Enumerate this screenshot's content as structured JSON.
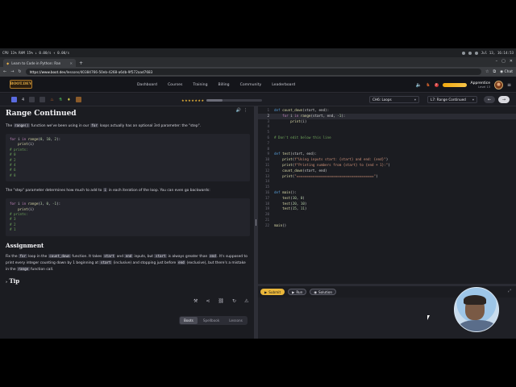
{
  "os": {
    "stats": "CPU 11% RAM 15% ↓ 0.00/s ↑ 0.00/s",
    "clock": "Jul 13, 16:14:53"
  },
  "browser": {
    "tab_title": "Learn to Code in Python: Ran",
    "url_host": "https://www.boot.dev",
    "url_path": "/lessons/40384766-50eb-4268-a6db-9f572aad7683",
    "chat_label": "Chat"
  },
  "site": {
    "logo_text": "BOOT.DEV",
    "nav": [
      "Dashboard",
      "Courses",
      "Training",
      "Billing",
      "Community",
      "Leaderboard"
    ],
    "rank_title": "Apprentice",
    "rank_level": "Level 13",
    "notif_count": "2"
  },
  "subbar": {
    "gems": "4",
    "stars": "★★★★★★★",
    "progress_fraction": 0.3,
    "chapter_select": "CH6: Loops",
    "lesson_select": "L7: Range Continued"
  },
  "lesson": {
    "title": "Range Continued",
    "p1_a": "The ",
    "p1_code1": "range()",
    "p1_b": " function we've been using in our ",
    "p1_code2": "for",
    "p1_c": " loops actually has an optional 3rd parameter: the \"step\".",
    "p2_a": "The \"step\" parameter determines how much to add to ",
    "p2_code": "i",
    "p2_b": " in each iteration of the loop. You can even go backwards:",
    "assignment_heading": "Assignment",
    "a_1": "Fix the ",
    "a_c1": "for",
    "a_2": " loop in the ",
    "a_c2": "count_down",
    "a_3": " function. It takes ",
    "a_c3": "start",
    "a_4": " and ",
    "a_c4": "end",
    "a_5": " inputs, but ",
    "a_c5": "start",
    "a_6": " is always greater than ",
    "a_c6": "end",
    "a_7": ". It's supposed to print every integer counting down by 1 beginning at ",
    "a_c7": "start",
    "a_8": " (inclusive) and stopping just before ",
    "a_c8": "end",
    "a_9": " (exclusive), but there's a mistake in the ",
    "a_c9": "range",
    "a_10": " function call.",
    "tip_label": "Tip"
  },
  "bottom_tabs": [
    "Boots",
    "Spellbook",
    "Lessons"
  ],
  "run_buttons": {
    "submit": "Submit",
    "run": "Run",
    "solution": "Solution"
  }
}
